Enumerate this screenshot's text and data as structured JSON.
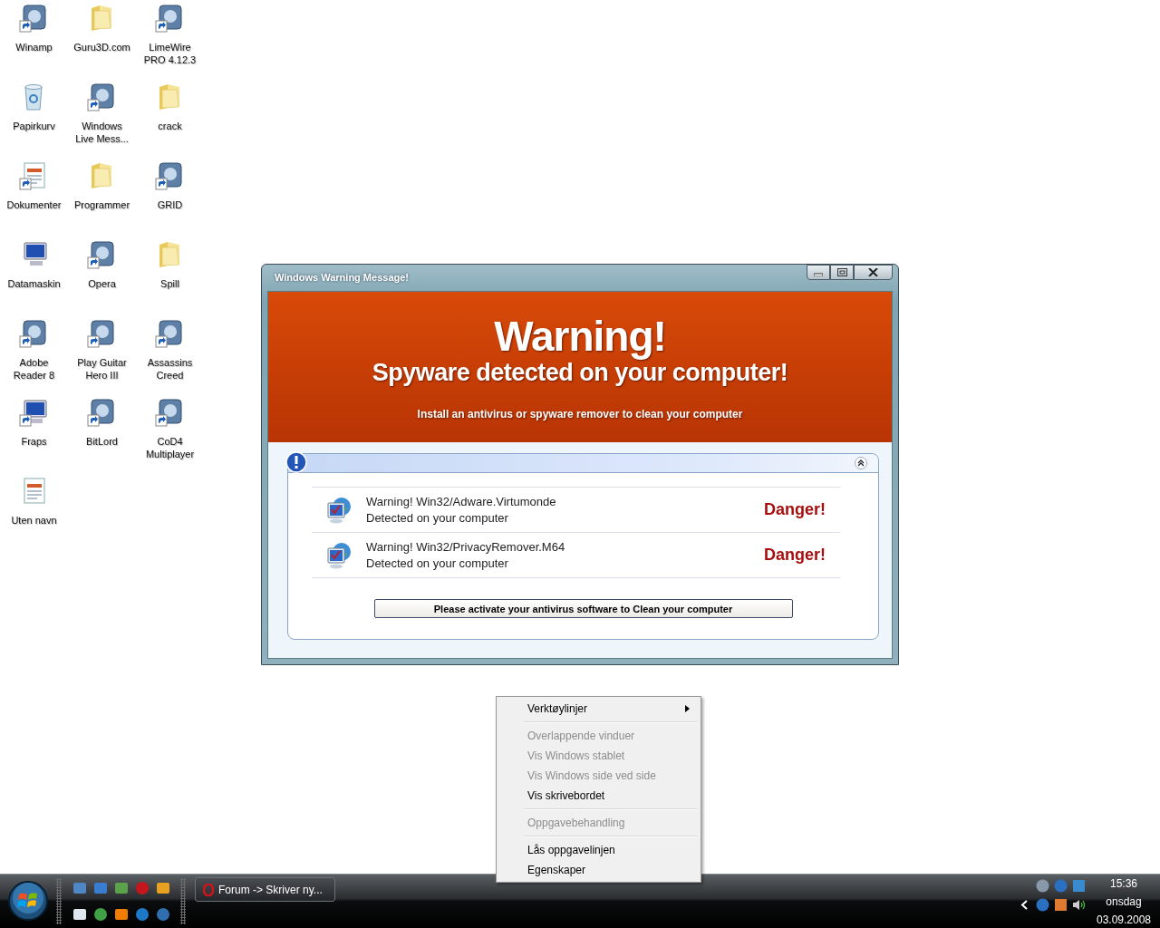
{
  "desktop_icons": [
    {
      "label": "Winamp",
      "kind": "app",
      "shortcut": true
    },
    {
      "label": "Guru3D.com",
      "kind": "folder",
      "shortcut": false
    },
    {
      "label": "LimeWire PRO 4.12.3",
      "kind": "app",
      "shortcut": true
    },
    {
      "label": "Papirkurv",
      "kind": "recycle",
      "shortcut": false
    },
    {
      "label": "Windows Live Mess...",
      "kind": "app",
      "shortcut": true
    },
    {
      "label": "crack",
      "kind": "folder",
      "shortcut": false
    },
    {
      "label": "Dokumenter",
      "kind": "document",
      "shortcut": true
    },
    {
      "label": "Programmer",
      "kind": "folder",
      "shortcut": false
    },
    {
      "label": "GRID",
      "kind": "app",
      "shortcut": true
    },
    {
      "label": "Datamaskin",
      "kind": "computer",
      "shortcut": false
    },
    {
      "label": "Opera",
      "kind": "app",
      "shortcut": true
    },
    {
      "label": "Spill",
      "kind": "folder",
      "shortcut": false
    },
    {
      "label": "Adobe Reader 8",
      "kind": "app",
      "shortcut": true
    },
    {
      "label": "Play Guitar Hero III",
      "kind": "app",
      "shortcut": true
    },
    {
      "label": "Assassins Creed",
      "kind": "app",
      "shortcut": true
    },
    {
      "label": "Fraps",
      "kind": "computer",
      "shortcut": true
    },
    {
      "label": "BitLord",
      "kind": "app",
      "shortcut": true
    },
    {
      "label": "CoD4 Multiplayer",
      "kind": "app",
      "shortcut": true
    },
    {
      "label": "Uten navn",
      "kind": "document",
      "shortcut": false
    }
  ],
  "warning_window": {
    "title": "Windows Warning Message!",
    "heading": "Warning!",
    "subheading": "Spyware detected on your computer!",
    "instruction": "Install an antivirus or spyware remover to clean your computer",
    "threats": [
      {
        "name": "Warning! Win32/Adware.Virtumonde",
        "detail": "Detected on your computer",
        "status": "Danger!"
      },
      {
        "name": "Warning! Win32/PrivacyRemover.M64",
        "detail": "Detected on your computer",
        "status": "Danger!"
      }
    ],
    "button": "Please activate your antivirus software to Clean your computer"
  },
  "context_menu": {
    "groups": [
      [
        {
          "label": "Verktøylinjer",
          "disabled": false,
          "submenu": true
        }
      ],
      [
        {
          "label": "Overlappende vinduer",
          "disabled": true,
          "submenu": false
        },
        {
          "label": "Vis Windows stablet",
          "disabled": true,
          "submenu": false
        },
        {
          "label": "Vis Windows side ved side",
          "disabled": true,
          "submenu": false
        },
        {
          "label": "Vis skrivebordet",
          "disabled": false,
          "submenu": false
        }
      ],
      [
        {
          "label": "Oppgavebehandling",
          "disabled": true,
          "submenu": false
        }
      ],
      [
        {
          "label": "Lås oppgavelinjen",
          "disabled": false,
          "submenu": false
        },
        {
          "label": "Egenskaper",
          "disabled": false,
          "submenu": false
        }
      ]
    ]
  },
  "taskbar": {
    "task_buttons": [
      {
        "label": "Forum -> Skriver ny..."
      }
    ],
    "clock": {
      "time": "15:36",
      "day": "onsdag",
      "date": "03.09.2008"
    }
  }
}
